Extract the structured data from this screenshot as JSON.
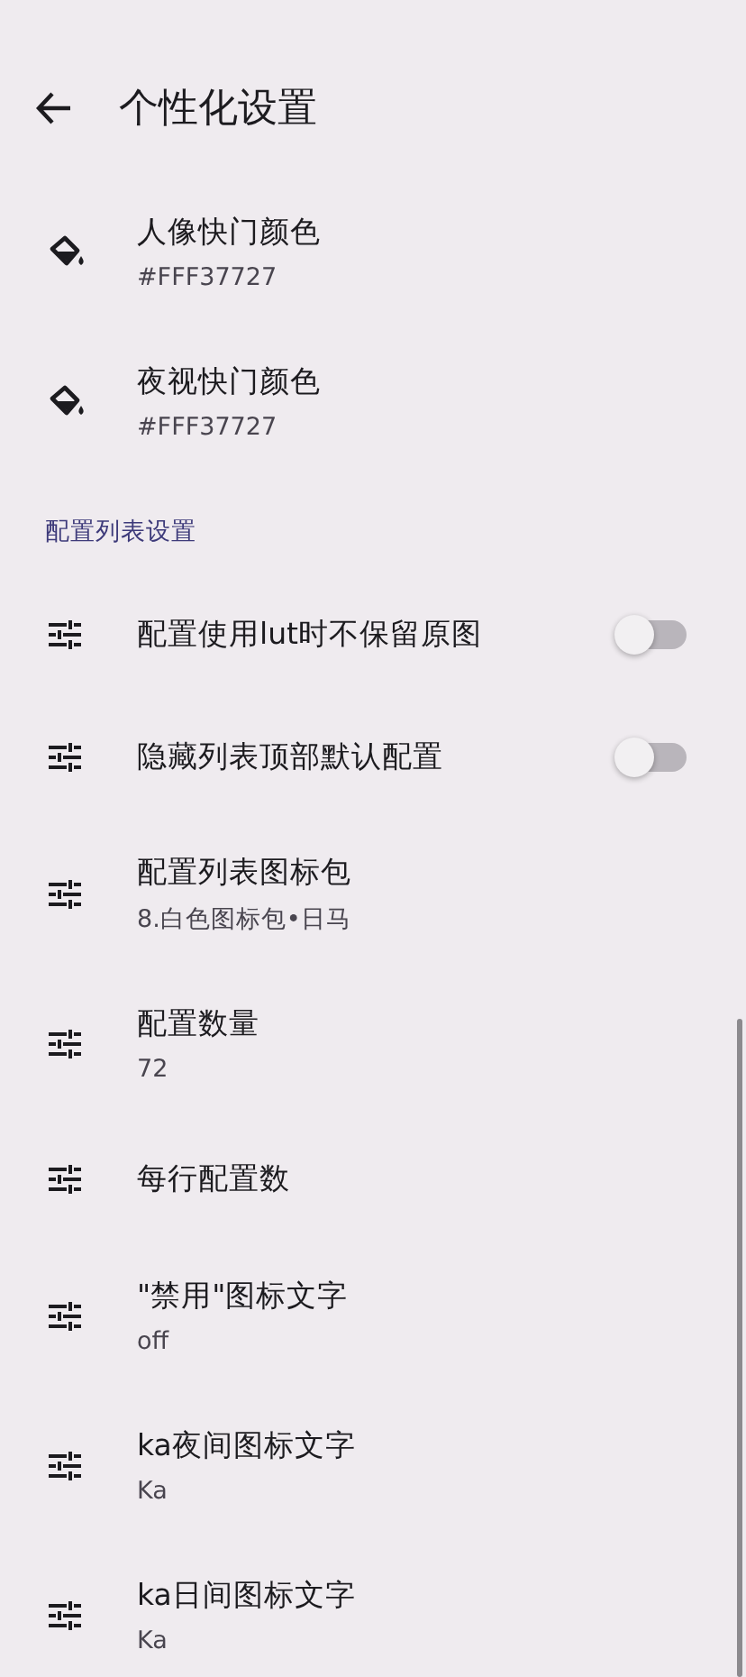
{
  "header": {
    "title": "个性化设置"
  },
  "groups": [
    {
      "items": [
        {
          "kind": "color",
          "title": "人像快门颜色",
          "summary": "#FFF37727"
        },
        {
          "kind": "color",
          "title": "夜视快门颜色",
          "summary": "#FFF37727"
        }
      ]
    },
    {
      "heading": "配置列表设置",
      "items": [
        {
          "kind": "switch",
          "title": "配置使用lut时不保留原图",
          "on": false
        },
        {
          "kind": "switch",
          "title": "隐藏列表顶部默认配置",
          "on": false
        },
        {
          "kind": "option",
          "title": "配置列表图标包",
          "summary": "8.白色图标包•日马"
        },
        {
          "kind": "option",
          "title": "配置数量",
          "summary": "72"
        },
        {
          "kind": "option",
          "title": "每行配置数"
        },
        {
          "kind": "option",
          "title": "\"禁用\"图标文字",
          "summary": "off"
        },
        {
          "kind": "option",
          "title": "ka夜间图标文字",
          "summary": "Ka"
        },
        {
          "kind": "option",
          "title": "ka日间图标文字",
          "summary": "Ka"
        }
      ]
    }
  ]
}
